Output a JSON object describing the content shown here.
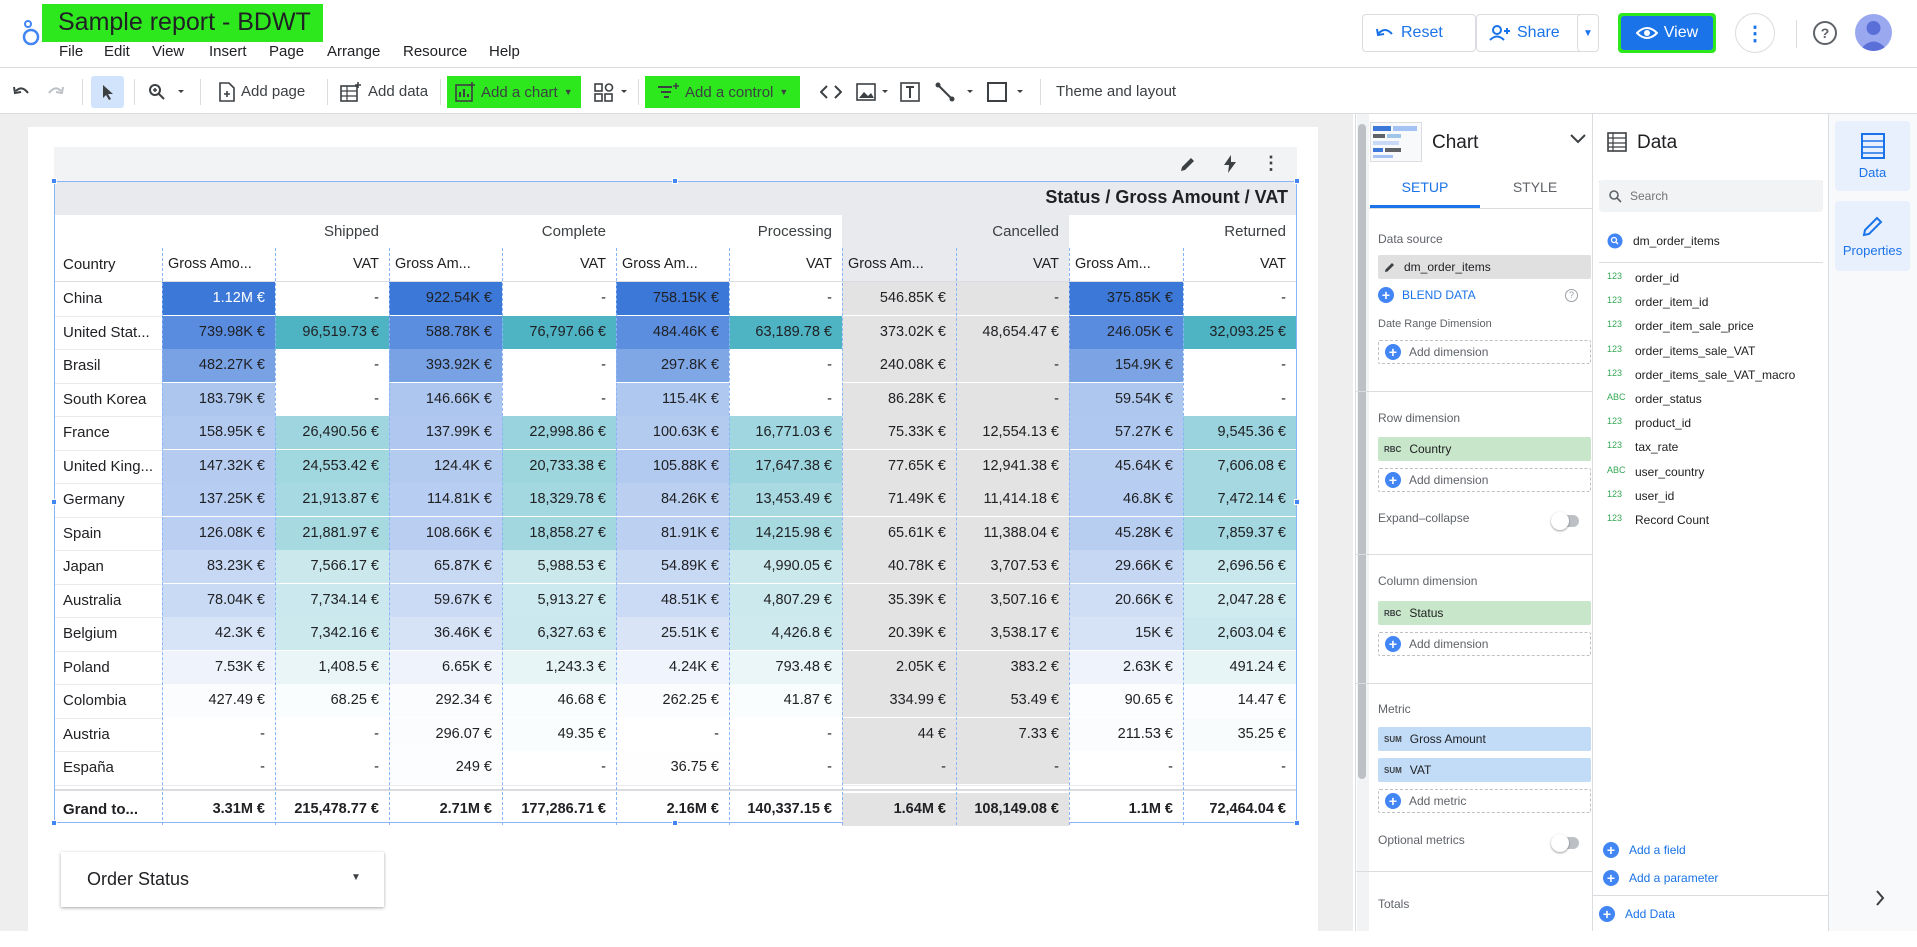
{
  "header": {
    "title": "Sample report - BDWT",
    "menus": [
      "File",
      "Edit",
      "View",
      "Insert",
      "Page",
      "Arrange",
      "Resource",
      "Help"
    ],
    "reset_label": "Reset",
    "share_label": "Share",
    "view_label": "View"
  },
  "toolbar": {
    "add_page": "Add page",
    "add_data": "Add data",
    "add_chart": "Add a chart",
    "add_control": "Add a control",
    "theme_layout": "Theme and layout"
  },
  "table": {
    "title": "Status / Gross Amount / VAT",
    "row_header": "Country",
    "statuses": [
      "Shipped",
      "Complete",
      "Processing",
      "Cancelled",
      "Returned"
    ],
    "metric_labels": [
      "Gross Amo...",
      "VAT",
      "Gross Am...",
      "VAT",
      "Gross Am...",
      "VAT",
      "Gross Am...",
      "VAT",
      "Gross Am...",
      "VAT"
    ],
    "rows": [
      {
        "country": "China",
        "values": [
          "1.12M €",
          "-",
          "922.54K €",
          "-",
          "758.15K €",
          "-",
          "546.85K €",
          "-",
          "375.85K €",
          "-"
        ]
      },
      {
        "country": "United Stat...",
        "values": [
          "739.98K €",
          "96,519.73 €",
          "588.78K €",
          "76,797.66 €",
          "484.46K €",
          "63,189.78 €",
          "373.02K €",
          "48,654.47 €",
          "246.05K €",
          "32,093.25 €"
        ]
      },
      {
        "country": "Brasil",
        "values": [
          "482.27K €",
          "-",
          "393.92K €",
          "-",
          "297.8K €",
          "-",
          "240.08K €",
          "-",
          "154.9K €",
          "-"
        ]
      },
      {
        "country": "South Korea",
        "values": [
          "183.79K €",
          "-",
          "146.66K €",
          "-",
          "115.4K €",
          "-",
          "86.28K €",
          "-",
          "59.54K €",
          "-"
        ]
      },
      {
        "country": "France",
        "values": [
          "158.95K €",
          "26,490.56 €",
          "137.99K €",
          "22,998.86 €",
          "100.63K €",
          "16,771.03 €",
          "75.33K €",
          "12,554.13 €",
          "57.27K €",
          "9,545.36 €"
        ]
      },
      {
        "country": "United King...",
        "values": [
          "147.32K €",
          "24,553.42 €",
          "124.4K €",
          "20,733.38 €",
          "105.88K €",
          "17,647.38 €",
          "77.65K €",
          "12,941.38 €",
          "45.64K €",
          "7,606.08 €"
        ]
      },
      {
        "country": "Germany",
        "values": [
          "137.25K €",
          "21,913.87 €",
          "114.81K €",
          "18,329.78 €",
          "84.26K €",
          "13,453.49 €",
          "71.49K €",
          "11,414.18 €",
          "46.8K €",
          "7,472.14 €"
        ]
      },
      {
        "country": "Spain",
        "values": [
          "126.08K €",
          "21,881.97 €",
          "108.66K €",
          "18,858.27 €",
          "81.91K €",
          "14,215.98 €",
          "65.61K €",
          "11,388.04 €",
          "45.28K €",
          "7,859.37 €"
        ]
      },
      {
        "country": "Japan",
        "values": [
          "83.23K €",
          "7,566.17 €",
          "65.87K €",
          "5,988.53 €",
          "54.89K €",
          "4,990.05 €",
          "40.78K €",
          "3,707.53 €",
          "29.66K €",
          "2,696.56 €"
        ]
      },
      {
        "country": "Australia",
        "values": [
          "78.04K €",
          "7,734.14 €",
          "59.67K €",
          "5,913.27 €",
          "48.51K €",
          "4,807.29 €",
          "35.39K €",
          "3,507.16 €",
          "20.66K €",
          "2,047.28 €"
        ]
      },
      {
        "country": "Belgium",
        "values": [
          "42.3K €",
          "7,342.16 €",
          "36.46K €",
          "6,327.63 €",
          "25.51K €",
          "4,426.8 €",
          "20.39K €",
          "3,538.17 €",
          "15K €",
          "2,603.04 €"
        ]
      },
      {
        "country": "Poland",
        "values": [
          "7.53K €",
          "1,408.5 €",
          "6.65K €",
          "1,243.3 €",
          "4.24K €",
          "793.48 €",
          "2.05K €",
          "383.2 €",
          "2.63K €",
          "491.24 €"
        ]
      },
      {
        "country": "Colombia",
        "values": [
          "427.49 €",
          "68.25 €",
          "292.34 €",
          "46.68 €",
          "262.25 €",
          "41.87 €",
          "334.99 €",
          "53.49 €",
          "90.65 €",
          "14.47 €"
        ]
      },
      {
        "country": "Austria",
        "values": [
          "-",
          "-",
          "296.07 €",
          "49.35 €",
          "-",
          "-",
          "44 €",
          "7.33 €",
          "211.53 €",
          "35.25 €"
        ]
      },
      {
        "country": "España",
        "values": [
          "-",
          "-",
          "249 €",
          "-",
          "36.75 €",
          "-",
          "-",
          "-",
          "-",
          "-"
        ]
      }
    ],
    "grand_total": {
      "label": "Grand to...",
      "values": [
        "3.31M €",
        "215,478.77 €",
        "2.71M €",
        "177,286.71 €",
        "2.16M €",
        "140,337.15 €",
        "1.64M €",
        "108,149.08 €",
        "1.1M €",
        "72,464.04 €"
      ]
    }
  },
  "control": {
    "label": "Order Status"
  },
  "setup_panel": {
    "chart_label": "Chart",
    "tab_setup": "SETUP",
    "tab_style": "STYLE",
    "data_source_label": "Data source",
    "data_source": "dm_order_items",
    "blend_data": "BLEND DATA",
    "date_range_label": "Date Range Dimension",
    "add_dimension": "Add dimension",
    "row_dimension_label": "Row dimension",
    "row_dimension": "Country",
    "expand_collapse": "Expand–collapse",
    "column_dimension_label": "Column dimension",
    "column_dimension": "Status",
    "metric_label": "Metric",
    "metrics": [
      "Gross Amount",
      "VAT"
    ],
    "add_metric": "Add metric",
    "optional_metrics": "Optional metrics",
    "totals": "Totals"
  },
  "data_panel": {
    "title": "Data",
    "search_placeholder": "Search",
    "source": "dm_order_items",
    "fields": [
      {
        "type": "123",
        "name": "order_id"
      },
      {
        "type": "123",
        "name": "order_item_id"
      },
      {
        "type": "123",
        "name": "order_item_sale_price"
      },
      {
        "type": "123",
        "name": "order_items_sale_VAT"
      },
      {
        "type": "123",
        "name": "order_items_sale_VAT_macro"
      },
      {
        "type": "ABC",
        "name": "order_status"
      },
      {
        "type": "123",
        "name": "product_id"
      },
      {
        "type": "123",
        "name": "tax_rate"
      },
      {
        "type": "ABC",
        "name": "user_country"
      },
      {
        "type": "123",
        "name": "user_id"
      },
      {
        "type": "123",
        "name": "Record Count"
      }
    ],
    "add_field": "Add a field",
    "add_parameter": "Add a parameter",
    "add_data": "Add Data"
  },
  "rail": {
    "data": "Data",
    "properties": "Properties"
  },
  "colors": {
    "accent": "#1a73e8",
    "highlight_green": "#2ee81e",
    "heat_blue": "#3c78d8",
    "heat_teal": "#4eb3c3"
  }
}
